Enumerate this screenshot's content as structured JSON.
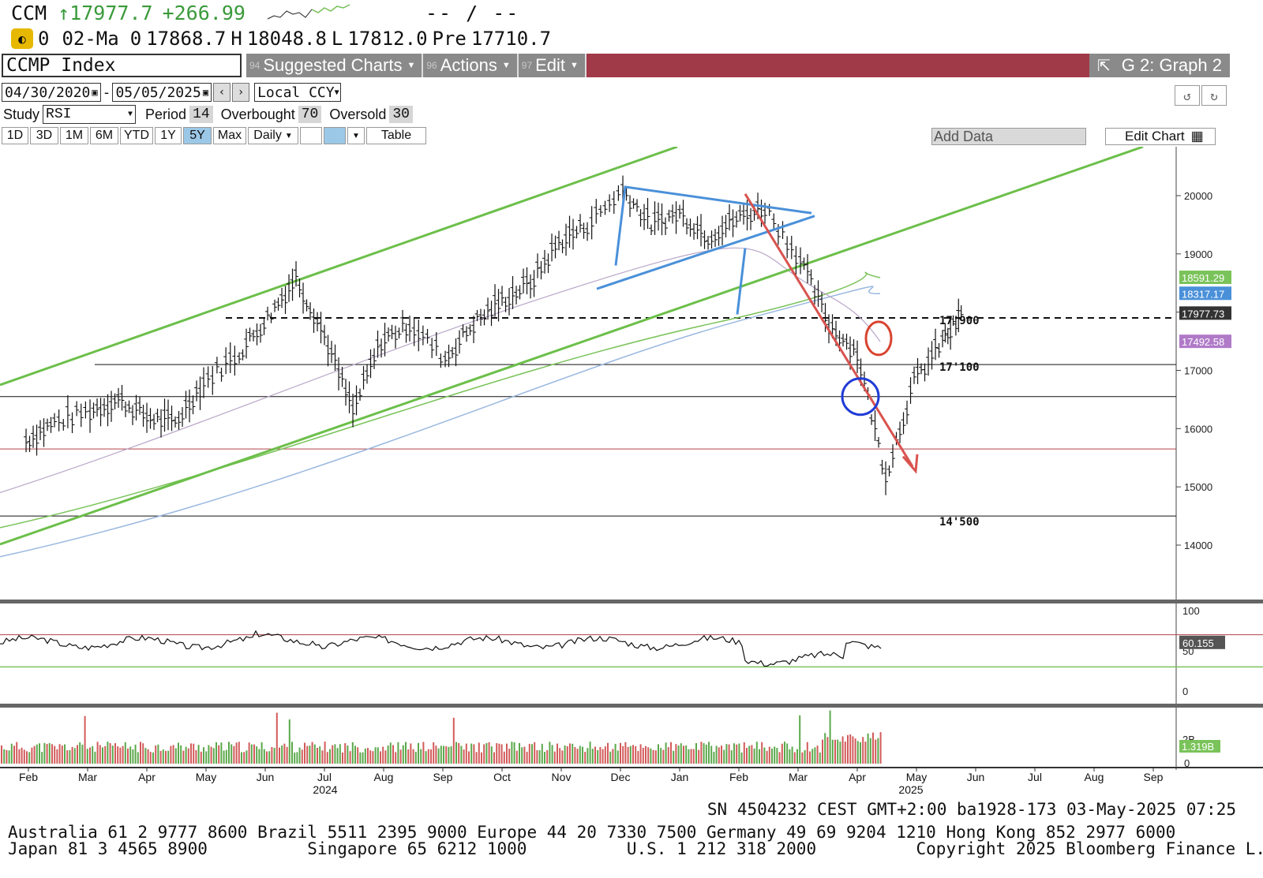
{
  "header": {
    "ticker": "CCM",
    "price": "↑17977.7",
    "change": "+266.99",
    "bidask": "-- / --",
    "row2_zero": "0",
    "date": "02-Ma",
    "open_label": "0",
    "open": "17868.7",
    "high_label": "H",
    "high": "18048.8",
    "low_label": "L",
    "low": "17812.0",
    "prev_label": "Pre",
    "prev": "17710.7"
  },
  "toolbar": {
    "security": "CCMP Index",
    "suggested_num": "94",
    "suggested": "Suggested Charts",
    "actions_num": "96",
    "actions": "Actions",
    "edit_num": "97",
    "edit": "Edit",
    "graph": "G 2: Graph 2"
  },
  "range": {
    "start": "04/30/2020",
    "sep": "-",
    "end": "05/05/2025",
    "currency": "Local CCY"
  },
  "study": {
    "label": "Study",
    "value": "RSI",
    "period_label": "Period",
    "period": "14",
    "overbought_label": "Overbought",
    "overbought": "70",
    "oversold_label": "Oversold",
    "oversold": "30"
  },
  "periods": [
    "1D",
    "3D",
    "1M",
    "6M",
    "YTD",
    "1Y",
    "5Y",
    "Max"
  ],
  "selected_period": "5Y",
  "frequency": "Daily",
  "table_label": "Table",
  "add_data": "Add Data",
  "edit_chart": "Edit Chart",
  "footer": {
    "line1": "SN 4504232 CEST GMT+2:00 ba1928-173 03-May-2025 07:25",
    "line2": "Australia 61 2 9777 8600 Brazil 5511 2395 9000 Europe 44 20 7330 7500 Germany 49 69 9204 1210 Hong Kong 852 2977 6000",
    "line3": "Japan 81 3 4565 8900          Singapore 65 6212 1000          U.S. 1 212 318 2000          Copyright 2025 Bloomberg Finance L.P."
  },
  "colors": {
    "up": "#3a9a3a",
    "toolbar": "#8a8a8a",
    "accent_bar": "#a13a48",
    "trend_red": "#d9534f",
    "triangle_blue": "#4a90d9",
    "channel_green": "#6cbf4a"
  },
  "chart_data": {
    "type": "candlestick",
    "price_axis": {
      "ticks": [
        14000,
        15000,
        16000,
        17000,
        18000,
        19000,
        20000
      ]
    },
    "price_labels": [
      {
        "text": "18591.29",
        "color": "#7ac35a"
      },
      {
        "text": "18317.17",
        "color": "#4a90d9"
      },
      {
        "text": "17977.73",
        "color": "#333333"
      },
      {
        "text": "17492.58",
        "color": "#b07ac8"
      }
    ],
    "levels": [
      {
        "value": 17900,
        "label": "17'900",
        "style": "dashed"
      },
      {
        "value": 17100,
        "label": "17'100",
        "style": "solid"
      },
      {
        "value": 16550,
        "label": "",
        "style": "solid"
      },
      {
        "value": 15650,
        "label": "",
        "style": "red"
      },
      {
        "value": 14500,
        "label": "14'500",
        "style": "solid"
      }
    ],
    "x_months": [
      "Feb",
      "Mar",
      "Apr",
      "May",
      "Jun",
      "Jul",
      "Aug",
      "Sep",
      "Oct",
      "Nov",
      "Dec",
      "Jan",
      "Feb",
      "Mar",
      "Apr",
      "May",
      "Jun",
      "Jul",
      "Aug",
      "Sep"
    ],
    "x_years": [
      "2024",
      "2025"
    ],
    "price_path": [
      [
        2024.08,
        15800
      ],
      [
        2024.12,
        16100
      ],
      [
        2024.17,
        16300
      ],
      [
        2024.21,
        16500
      ],
      [
        2024.25,
        16200
      ],
      [
        2024.29,
        16100
      ],
      [
        2024.33,
        16800
      ],
      [
        2024.38,
        17300
      ],
      [
        2024.42,
        17900
      ],
      [
        2024.46,
        18600
      ],
      [
        2024.5,
        17600
      ],
      [
        2024.54,
        16300
      ],
      [
        2024.58,
        17500
      ],
      [
        2024.62,
        17800
      ],
      [
        2024.67,
        17200
      ],
      [
        2024.71,
        17800
      ],
      [
        2024.75,
        18200
      ],
      [
        2024.79,
        18500
      ],
      [
        2024.83,
        19200
      ],
      [
        2024.87,
        19500
      ],
      [
        2024.92,
        20100
      ],
      [
        2024.96,
        19500
      ],
      [
        2025.0,
        19700
      ],
      [
        2025.04,
        19300
      ],
      [
        2025.08,
        19600
      ],
      [
        2025.12,
        19800
      ],
      [
        2025.17,
        18900
      ],
      [
        2025.21,
        17800
      ],
      [
        2025.25,
        17300
      ],
      [
        2025.29,
        15200
      ],
      [
        2025.33,
        16800
      ],
      [
        2025.37,
        17500
      ],
      [
        2025.4,
        17977
      ]
    ],
    "rsi": {
      "ticks": [
        0,
        50,
        100
      ],
      "last": "60.155",
      "overbought": 70,
      "oversold": 30
    },
    "volume": {
      "ticks": [
        "0",
        "2B"
      ],
      "last": "1.319B"
    }
  }
}
